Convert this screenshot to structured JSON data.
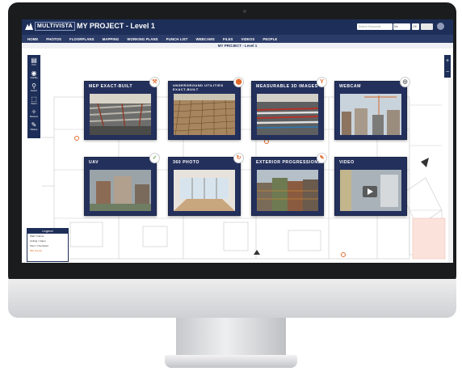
{
  "app": {
    "logo": "MULTIVISTA",
    "project_title": "MY PROJECT - Level 1",
    "subtitle": "MY PROJECT - Level 1",
    "search_placeholder": "Search Keywords",
    "select_a": "Mo",
    "select_b": "Off",
    "brand_color": "#1d2e58"
  },
  "nav": {
    "items": [
      "HOME",
      "PHOTOS",
      "FLOORPLANS",
      "MAPPING",
      "WORKING PLANS",
      "PUNCH LIST",
      "WEBCAMS",
      "FILES",
      "VIDEOS",
      "PEOPLE"
    ]
  },
  "toolbar": {
    "items": [
      {
        "icon": "print-icon",
        "label": "Print"
      },
      {
        "icon": "eye-icon",
        "label": "Visibility"
      },
      {
        "icon": "search-icon",
        "label": "Search"
      },
      {
        "icon": "select-icon",
        "label": "Select"
      },
      {
        "icon": "measure-icon",
        "label": "Measure"
      },
      {
        "icon": "markup-icon",
        "label": "Markup"
      }
    ]
  },
  "zoom": {
    "in": "+",
    "out": "−"
  },
  "cards": [
    {
      "title": "MEP EXACT-BUILT",
      "badge_icon": "crane-icon",
      "badge_color": "#e26a2c"
    },
    {
      "title": "UNDERGROUND UTILITIES EXACT-BUILT",
      "badge_icon": "pin-icon",
      "badge_color": "#e26a2c"
    },
    {
      "title": "MEASURABLE 3D IMAGES",
      "badge_icon": "y-icon",
      "badge_color": "#e26a2c"
    },
    {
      "title": "WEBCAM",
      "badge_icon": "webcam-icon",
      "badge_color": "#555555"
    },
    {
      "title": "UAV",
      "badge_icon": "check-icon",
      "badge_color": "#6aa84f"
    },
    {
      "title": "360 PHOTO",
      "badge_icon": "360-icon",
      "badge_color": "#e26a2c"
    },
    {
      "title": "EXTERIOR PROGRESSIONS",
      "badge_icon": "pencil-icon",
      "badge_color": "#e26a2c"
    },
    {
      "title": "VIDEO",
      "badge_icon": "",
      "badge_color": "#555555"
    }
  ],
  "legend": {
    "title": "Legend",
    "rows": [
      "Wall / Interior",
      "Ceiling / Upper",
      "Floor / Overhead",
      "360 Interior"
    ]
  }
}
